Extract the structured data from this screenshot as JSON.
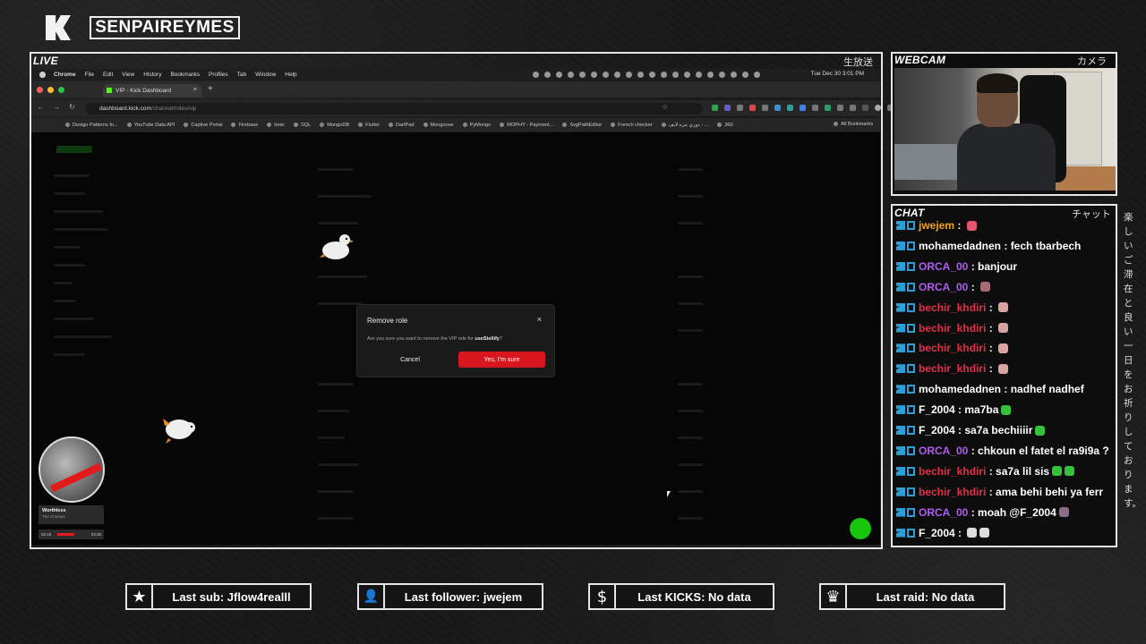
{
  "overlay": {
    "channel_name": "SENPAIREYMES",
    "live_label": "LIVE",
    "live_jp": "生放送",
    "webcam_label": "WEBCAM",
    "webcam_jp": "カメラ",
    "chat_label": "CHAT",
    "chat_jp": "チャット",
    "side_jp": "楽しいご滞在と良い一日をお祈りしております。"
  },
  "menubar": {
    "app": "Chrome",
    "items": [
      "File",
      "Edit",
      "View",
      "History",
      "Bookmarks",
      "Profiles",
      "Tab",
      "Window",
      "Help"
    ],
    "clock": "Tue Dec 30  3:01 PM"
  },
  "browser": {
    "tab_title": "VIP - Kick Dashboard",
    "tab_close": "×",
    "new_tab": "+",
    "url_host": "dashboard.kick.com",
    "url_path": "/channel/roles/vip",
    "bookmarks": [
      "Design Patterns In...",
      "YouTube Data API",
      "Captive Portal",
      "Firebase",
      "Ionic",
      "SQL",
      "MongoDB",
      "Flutter",
      "DartPad",
      "Mongoose",
      "PyMongo",
      "MOPHY - Payment...",
      "SvgPathEditor",
      "French checker",
      "دوري مزه لايف - ...",
      "360"
    ],
    "all_bookmarks": "All Bookmarks"
  },
  "modal": {
    "title": "Remove role",
    "close": "×",
    "body_prefix": "Are you sure you want to remove the VIP role for ",
    "body_user": "useStellify",
    "body_suffix": "?",
    "cancel": "Cancel",
    "confirm": "Yes, I'm sure"
  },
  "now_playing": {
    "title": "Worthless",
    "artist": "The Chumps",
    "elapsed": "02:18",
    "total": "03:38",
    "progress": 0.63
  },
  "chat": [
    {
      "user": "jwejem",
      "color": "#f7a21b",
      "text": "",
      "emotes": [
        "#e2566e"
      ]
    },
    {
      "user": "mohamedadnen",
      "color": "#ffffff",
      "text": "fech tbarbech",
      "emotes": []
    },
    {
      "user": "ORCA_00",
      "color": "#b05cf2",
      "text": "banjour",
      "emotes": []
    },
    {
      "user": "ORCA_00",
      "color": "#b05cf2",
      "text": "",
      "emotes": [
        "#a86b72"
      ]
    },
    {
      "user": "bechir_khdiri",
      "color": "#e0304a",
      "text": "",
      "emotes": [
        "#d9a3a0"
      ]
    },
    {
      "user": "bechir_khdiri",
      "color": "#e0304a",
      "text": "",
      "emotes": [
        "#d9a3a0"
      ]
    },
    {
      "user": "bechir_khdiri",
      "color": "#e0304a",
      "text": "",
      "emotes": [
        "#d9a3a0"
      ]
    },
    {
      "user": "bechir_khdiri",
      "color": "#e0304a",
      "text": "",
      "emotes": [
        "#d9a3a0"
      ]
    },
    {
      "user": "mohamedadnen",
      "color": "#ffffff",
      "text": "nadhef nadhef",
      "emotes": []
    },
    {
      "user": "F_2004",
      "color": "#ffffff",
      "text": "ma7ba",
      "emotes": [
        "#33c23a"
      ]
    },
    {
      "user": "F_2004",
      "color": "#ffffff",
      "text": "sa7a bechiiiir",
      "emotes": [
        "#33c23a"
      ]
    },
    {
      "user": "ORCA_00",
      "color": "#b05cf2",
      "text": "chkoun el fatet el ra9i9a ?",
      "emotes": []
    },
    {
      "user": "bechir_khdiri",
      "color": "#e0304a",
      "text": "sa7a lil sis",
      "emotes": [
        "#33c23a",
        "#33c23a"
      ]
    },
    {
      "user": "bechir_khdiri",
      "color": "#e0304a",
      "text": "ama behi behi ya ferr",
      "emotes": []
    },
    {
      "user": "ORCA_00",
      "color": "#b05cf2",
      "text": "moah @F_2004",
      "emotes": [
        "#8c6d86"
      ]
    },
    {
      "user": "F_2004",
      "color": "#ffffff",
      "text": "",
      "emotes": [
        "#dddddd",
        "#dddddd"
      ]
    }
  ],
  "stats": [
    {
      "icon": "star-icon",
      "glyph": "★",
      "text": "Last sub: Jflow4realll"
    },
    {
      "icon": "add-user-icon",
      "glyph": "👤",
      "text": "Last follower: jwejem"
    },
    {
      "icon": "dollar-icon",
      "glyph": "$",
      "text": "Last KICKS: No data"
    },
    {
      "icon": "crown-icon",
      "glyph": "♛",
      "text": "Last raid: No data"
    }
  ]
}
